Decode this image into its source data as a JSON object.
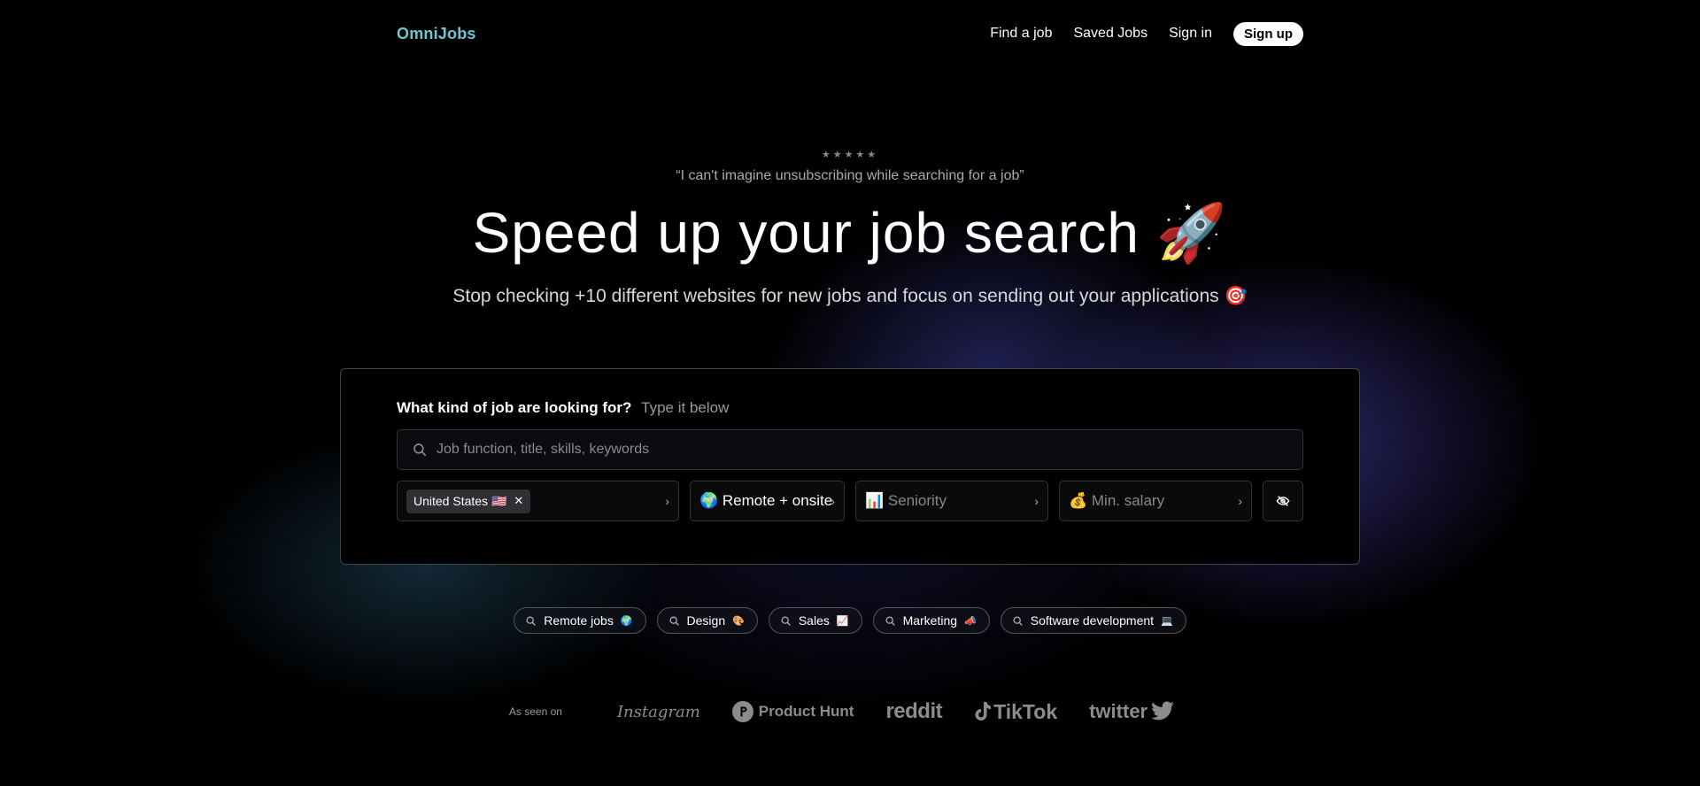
{
  "nav": {
    "logo": "OmniJobs",
    "links": [
      "Find a job",
      "Saved Jobs",
      "Sign in"
    ],
    "signup": "Sign up"
  },
  "hero": {
    "stars": "★★★★★",
    "quote": "“I can't imagine unsubscribing while searching for a job”",
    "headline": "Speed up your job search 🚀",
    "subline": "Stop checking +10 different websites for new jobs and focus on sending out your applications 🎯"
  },
  "search": {
    "question": "What kind of job are looking for?",
    "hint": "Type it below",
    "placeholder": "Job function, title, skills, keywords",
    "location_tag": "United States 🇺🇸",
    "remote_filter": "🌍 Remote + onsite",
    "seniority_placeholder": "📊 Seniority",
    "salary_placeholder": "💰 Min. salary"
  },
  "quick_searches": [
    {
      "label": "Remote jobs",
      "emoji": "🌍"
    },
    {
      "label": "Design",
      "emoji": "🎨"
    },
    {
      "label": "Sales",
      "emoji": "📈"
    },
    {
      "label": "Marketing",
      "emoji": "📣"
    },
    {
      "label": "Software development",
      "emoji": "💻"
    }
  ],
  "seen_on": {
    "label": "As seen on",
    "brands": [
      "Instagram",
      "Product Hunt",
      "reddit",
      "TikTok",
      "twitter"
    ]
  },
  "colors": {
    "logo": "#6cc6d4",
    "background": "#000000",
    "glow_purple": "#5046be"
  },
  "icons": [
    "search-icon",
    "close-icon",
    "chevron-right-icon",
    "eye-off-icon",
    "product-hunt-icon",
    "tiktok-icon",
    "twitter-bird-icon"
  ]
}
